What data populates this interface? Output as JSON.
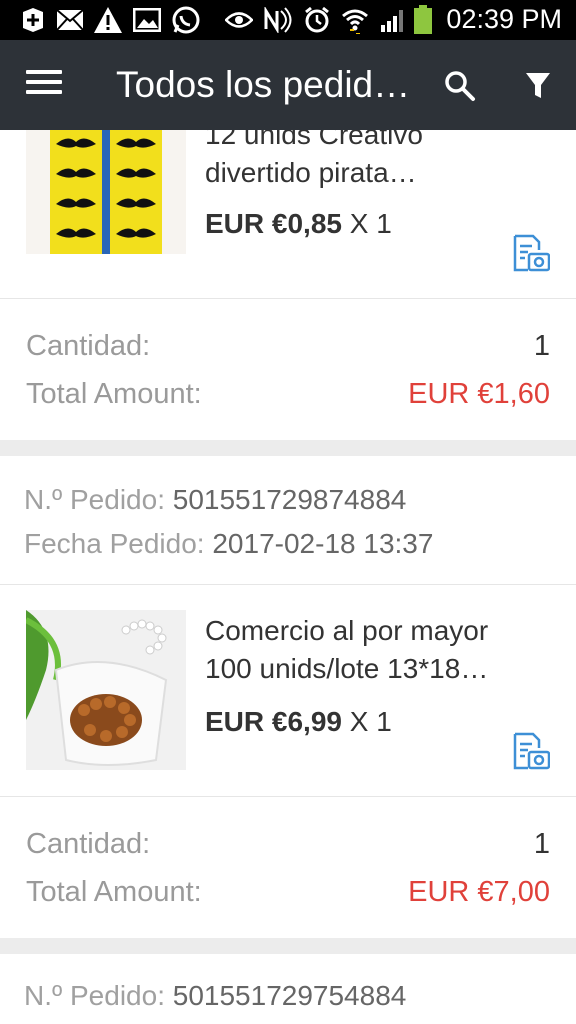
{
  "status_bar": {
    "time": "02:39 PM",
    "icons": [
      "add-notification-icon",
      "mail-icon",
      "warning-icon",
      "image-icon",
      "whatsapp-icon",
      "eye-icon",
      "nfc-icon",
      "alarm-icon",
      "wifi-icon",
      "signal-icon",
      "battery-icon"
    ]
  },
  "app_bar": {
    "title": "Todos los pedid…",
    "menu_icon": "menu-icon",
    "search_icon": "search-icon",
    "filter_icon": "filter-icon"
  },
  "orders": [
    {
      "item": {
        "title_line1": "12 unids Creativo",
        "title_line2": "divertido pirata…",
        "price": "EUR €0,85",
        "qty": "X 1"
      },
      "cantidad_label": "Cantidad:",
      "cantidad_value": "1",
      "total_label": "Total Amount:",
      "total_value": "EUR €1,60"
    },
    {
      "order_no_label": "N.º Pedido:",
      "order_no": "501551729874884",
      "date_label": "Fecha Pedido:",
      "date": "2017-02-18 13:37",
      "item": {
        "title_line1": "Comercio al por mayor",
        "title_line2": "100 unids/lote 13*18…",
        "price": "EUR €6,99",
        "qty": "X 1"
      },
      "cantidad_label": "Cantidad:",
      "cantidad_value": "1",
      "total_label": "Total Amount:",
      "total_value": "EUR €7,00"
    },
    {
      "order_no_label": "N.º Pedido:",
      "order_no": "501551729754884"
    }
  ],
  "colors": {
    "app_bar": "#2d3238",
    "total_red": "#e0413a",
    "icon_blue": "#3d8fd6"
  }
}
